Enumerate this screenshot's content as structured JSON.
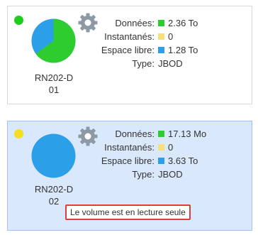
{
  "colors": {
    "data": "#2fcc2f",
    "snapshots": "#f5e07a",
    "free": "#2ba0e8",
    "status_ok": "#1fcc1f",
    "status_warn": "#f5dd1f",
    "gear": "#8d9aa5",
    "alert_border": "#e23b3b"
  },
  "volumes": [
    {
      "name_line1": "RN202-D",
      "name_line2": "01",
      "status": "ok",
      "status_icon": "green-status-dot",
      "gear_icon": "gear-icon",
      "stats": {
        "data_label": "Données:",
        "data_value": "2.36 To",
        "snap_label": "Instantanés:",
        "snap_value": "0",
        "free_label": "Espace libre:",
        "free_value": "1.28 To",
        "type_label": "Type:",
        "type_value": "JBOD"
      },
      "usage": {
        "data_fraction": 0.65,
        "free_fraction": 0.35
      }
    },
    {
      "name_line1": "RN202-D",
      "name_line2": "02",
      "status": "warning",
      "status_icon": "yellow-status-dot",
      "gear_icon": "gear-icon",
      "stats": {
        "data_label": "Données:",
        "data_value": "17.13 Mo",
        "snap_label": "Instantanés:",
        "snap_value": "0",
        "free_label": "Espace libre:",
        "free_value": "3.63 To",
        "type_label": "Type:",
        "type_value": "JBOD"
      },
      "usage": {
        "data_fraction": 0.0,
        "free_fraction": 1.0
      },
      "alert": "Le volume est en lecture seule"
    }
  ]
}
